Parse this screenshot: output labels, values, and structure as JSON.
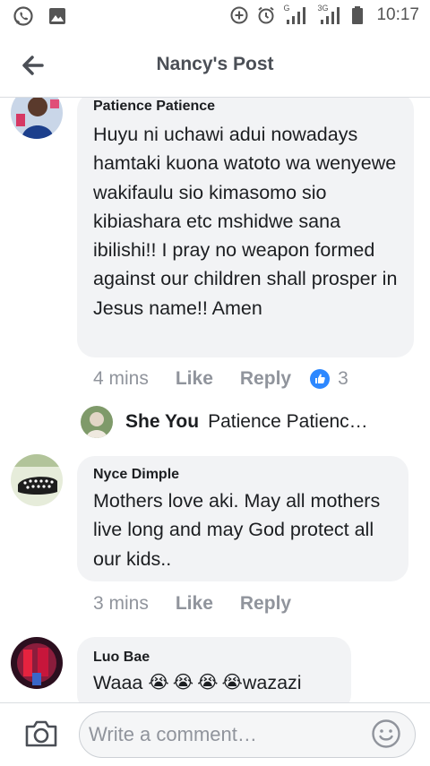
{
  "status_bar": {
    "time": "10:17",
    "net1": "G",
    "net2": "3G"
  },
  "header": {
    "title": "Nancy's Post"
  },
  "comments": [
    {
      "author": "Patience Patience",
      "text": "Huyu ni uchawi adui nowadays hamtaki kuona watoto wa wenyewe wakifaulu sio kimasomo sio kibiashara etc mshidwe sana ibilishi!! I pray no weapon formed against our children shall prosper in Jesus name!! Amen",
      "time": "4 mins",
      "like_label": "Like",
      "reply_label": "Reply",
      "reaction_count": "3",
      "reply_preview": {
        "author": "She You",
        "snippet": "Patience Patienc…"
      }
    },
    {
      "author": "Nyce Dimple",
      "text": "Mothers love aki. May all mothers live long and may God protect all our kids..",
      "time": "3 mins",
      "like_label": "Like",
      "reply_label": "Reply"
    },
    {
      "author": "Luo Bae",
      "text_start": "Waaa ",
      "text_end": "wazazi",
      "emoji": [
        "😭",
        "😭",
        "😭",
        "😭"
      ]
    }
  ],
  "composer": {
    "placeholder": "Write a comment…"
  },
  "colors": {
    "link": "#90949c",
    "bubble": "#f2f3f5",
    "like_blue": "#2d88ff",
    "cry_yellow": "#f7b928"
  },
  "icons": [
    "whatsapp-icon",
    "gallery-icon",
    "data-saver-icon",
    "alarm-icon",
    "signal-icon",
    "battery-icon",
    "back-arrow-icon",
    "like-reaction-icon",
    "camera-icon",
    "emoji-icon"
  ]
}
